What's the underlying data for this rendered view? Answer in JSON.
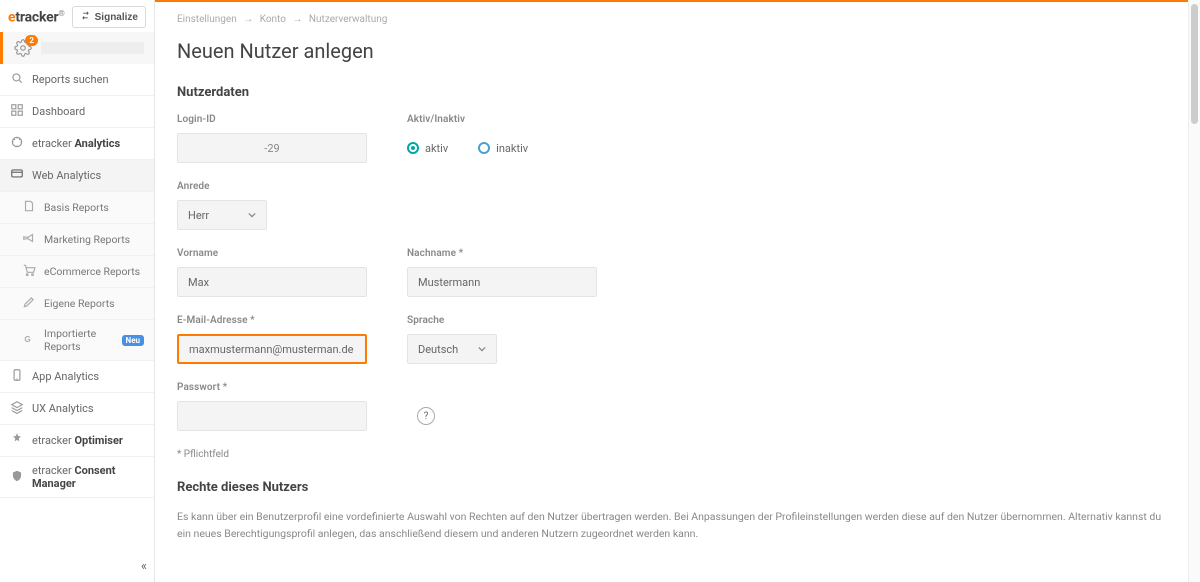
{
  "brand": {
    "pre": "e",
    "rest": "tracker"
  },
  "signalize_label": "Signalize",
  "user_badge": "2",
  "sidebar": {
    "search": "Reports suchen",
    "dashboard": "Dashboard",
    "analytics_pre": "etracker",
    "analytics_strong": "Analytics",
    "web_analytics": "Web Analytics",
    "basis_reports": "Basis Reports",
    "marketing_reports": "Marketing Reports",
    "ecommerce_reports": "eCommerce Reports",
    "eigene_reports": "Eigene Reports",
    "importierte_reports": "Importierte Reports",
    "neu_badge": "Neu",
    "app_analytics": "App Analytics",
    "ux_analytics": "UX Analytics",
    "optimiser_pre": "etracker",
    "optimiser_strong": "Optimiser",
    "consent_pre": "etracker",
    "consent_strong": "Consent Manager"
  },
  "breadcrumb": {
    "a": "Einstellungen",
    "b": "Konto",
    "c": "Nutzerverwaltung"
  },
  "page_title": "Neuen Nutzer anlegen",
  "section_user_data": "Nutzerdaten",
  "fields": {
    "login_id_label": "Login-ID",
    "login_id_value": "-29",
    "active_label": "Aktiv/Inaktiv",
    "active_opt": "aktiv",
    "inactive_opt": "inaktiv",
    "salutation_label": "Anrede",
    "salutation_value": "Herr",
    "firstname_label": "Vorname",
    "firstname_value": "Max",
    "lastname_label": "Nachname *",
    "lastname_value": "Mustermann",
    "email_label": "E-Mail-Adresse *",
    "email_value": "maxmustermann@musterman.de",
    "language_label": "Sprache",
    "language_value": "Deutsch",
    "password_label": "Passwort *",
    "password_value": ""
  },
  "mandatory_note": "* Pflichtfeld",
  "section_rights": "Rechte dieses Nutzers",
  "rights_desc": "Es kann über ein Benutzerprofil eine vordefinierte Auswahl von Rechten auf den Nutzer übertragen werden. Bei Anpassungen der Profileinstellungen werden diese auf den Nutzer übernommen. Alternativ kannst du ein neues Berechtigungsprofil anlegen, das anschließend diesem und anderen Nutzern zugeordnet werden kann."
}
